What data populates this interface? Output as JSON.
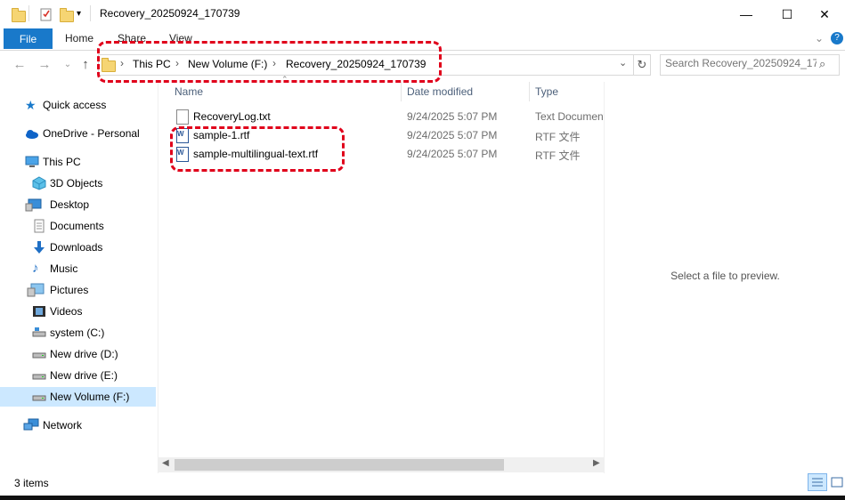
{
  "window": {
    "title": "Recovery_20250924_170739",
    "min": "—",
    "max": "☐",
    "close": "✕"
  },
  "ribbon": {
    "file_label": "File",
    "tabs": [
      "Home",
      "Share",
      "View"
    ]
  },
  "address": {
    "crumbs": [
      "This PC",
      "New Volume (F:)",
      "Recovery_20250924_170739"
    ],
    "search_placeholder": "Search Recovery_20250924_17..."
  },
  "sidebar": {
    "items": [
      {
        "label": "Quick access",
        "icon": "star-icon"
      },
      {
        "label": "OneDrive - Personal",
        "icon": "cloud-icon"
      },
      {
        "label": "This PC",
        "icon": "computer-icon"
      },
      {
        "label": "3D Objects",
        "icon": "cube-icon"
      },
      {
        "label": "Desktop",
        "icon": "desktop-icon"
      },
      {
        "label": "Documents",
        "icon": "document-icon"
      },
      {
        "label": "Downloads",
        "icon": "download-icon"
      },
      {
        "label": "Music",
        "icon": "music-icon"
      },
      {
        "label": "Pictures",
        "icon": "picture-icon"
      },
      {
        "label": "Videos",
        "icon": "video-icon"
      },
      {
        "label": "system (C:)",
        "icon": "drive-icon"
      },
      {
        "label": "New drive (D:)",
        "icon": "drive-icon"
      },
      {
        "label": "New drive (E:)",
        "icon": "drive-icon"
      },
      {
        "label": "New Volume (F:)",
        "icon": "drive-icon"
      },
      {
        "label": "Network",
        "icon": "network-icon"
      }
    ]
  },
  "columns": {
    "name": "Name",
    "date": "Date modified",
    "type": "Type"
  },
  "files": [
    {
      "name": "RecoveryLog.txt",
      "date": "9/24/2025 5:07 PM",
      "type": "Text Document",
      "icon": "text-file-icon"
    },
    {
      "name": "sample-1.rtf",
      "date": "9/24/2025 5:07 PM",
      "type": "RTF 文件",
      "icon": "word-file-icon"
    },
    {
      "name": "sample-multilingual-text.rtf",
      "date": "9/24/2025 5:07 PM",
      "type": "RTF 文件",
      "icon": "word-file-icon"
    }
  ],
  "preview": {
    "empty_text": "Select a file to preview."
  },
  "status": {
    "item_count": "3 items"
  },
  "colors": {
    "accent": "#1979ca",
    "selection": "#cce8ff",
    "annotation": "#e0001b"
  }
}
